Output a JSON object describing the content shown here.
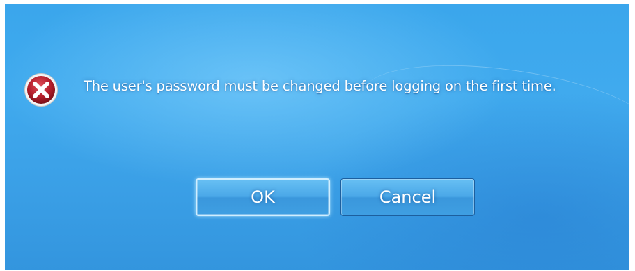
{
  "dialog": {
    "message": "The user's password must be changed before logging on the first time.",
    "icon": "error-icon"
  },
  "buttons": {
    "ok_label": "OK",
    "cancel_label": "Cancel"
  },
  "colors": {
    "background": "#3aa6ec",
    "error_red": "#b01e2a",
    "text": "#ffffff"
  }
}
